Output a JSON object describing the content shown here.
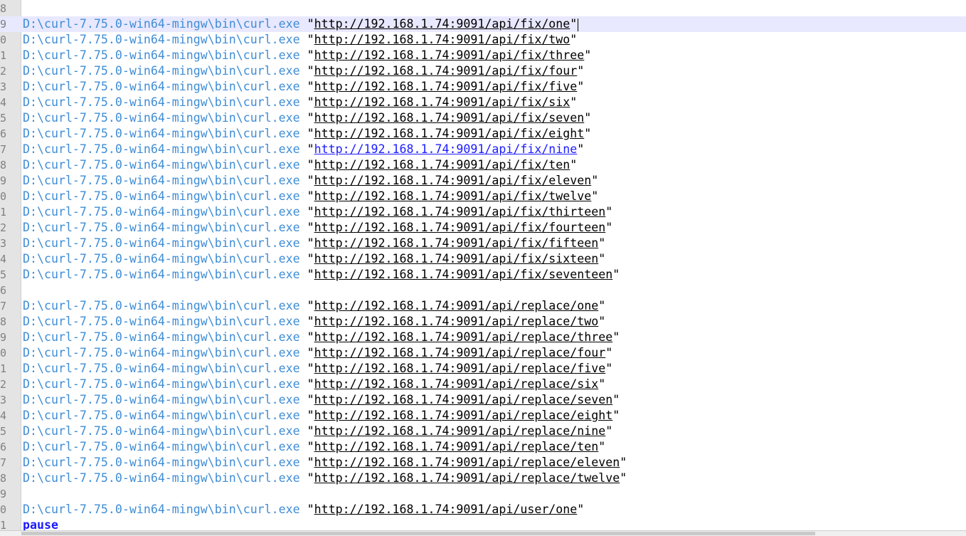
{
  "editor": {
    "curl_path": "D:\\curl-7.75.0-win64-mingw\\bin\\curl.exe",
    "quote": "\"",
    "lines": [
      {
        "num": "8",
        "url": "",
        "keyword": ""
      },
      {
        "num": "9",
        "url": "http://192.168.1.74:9091/api/fix/one",
        "keyword": ""
      },
      {
        "num": "0",
        "url": "http://192.168.1.74:9091/api/fix/two",
        "keyword": ""
      },
      {
        "num": "1",
        "url": "http://192.168.1.74:9091/api/fix/three",
        "keyword": ""
      },
      {
        "num": "2",
        "url": "http://192.168.1.74:9091/api/fix/four",
        "keyword": ""
      },
      {
        "num": "3",
        "url": "http://192.168.1.74:9091/api/fix/five",
        "keyword": ""
      },
      {
        "num": "4",
        "url": "http://192.168.1.74:9091/api/fix/six",
        "keyword": ""
      },
      {
        "num": "5",
        "url": "http://192.168.1.74:9091/api/fix/seven",
        "keyword": ""
      },
      {
        "num": "6",
        "url": "http://192.168.1.74:9091/api/fix/eight",
        "keyword": ""
      },
      {
        "num": "7",
        "url": "http://192.168.1.74:9091/api/fix/nine",
        "keyword": ""
      },
      {
        "num": "8",
        "url": "http://192.168.1.74:9091/api/fix/ten",
        "keyword": ""
      },
      {
        "num": "9",
        "url": "http://192.168.1.74:9091/api/fix/eleven",
        "keyword": ""
      },
      {
        "num": "0",
        "url": "http://192.168.1.74:9091/api/fix/twelve",
        "keyword": ""
      },
      {
        "num": "1",
        "url": "http://192.168.1.74:9091/api/fix/thirteen",
        "keyword": ""
      },
      {
        "num": "2",
        "url": "http://192.168.1.74:9091/api/fix/fourteen",
        "keyword": ""
      },
      {
        "num": "3",
        "url": "http://192.168.1.74:9091/api/fix/fifteen",
        "keyword": ""
      },
      {
        "num": "4",
        "url": "http://192.168.1.74:9091/api/fix/sixteen",
        "keyword": ""
      },
      {
        "num": "5",
        "url": "http://192.168.1.74:9091/api/fix/seventeen",
        "keyword": ""
      },
      {
        "num": "6",
        "url": "",
        "keyword": ""
      },
      {
        "num": "7",
        "url": "http://192.168.1.74:9091/api/replace/one",
        "keyword": ""
      },
      {
        "num": "8",
        "url": "http://192.168.1.74:9091/api/replace/two",
        "keyword": ""
      },
      {
        "num": "9",
        "url": "http://192.168.1.74:9091/api/replace/three",
        "keyword": ""
      },
      {
        "num": "0",
        "url": "http://192.168.1.74:9091/api/replace/four",
        "keyword": ""
      },
      {
        "num": "1",
        "url": "http://192.168.1.74:9091/api/replace/five",
        "keyword": ""
      },
      {
        "num": "2",
        "url": "http://192.168.1.74:9091/api/replace/six",
        "keyword": ""
      },
      {
        "num": "3",
        "url": "http://192.168.1.74:9091/api/replace/seven",
        "keyword": ""
      },
      {
        "num": "4",
        "url": "http://192.168.1.74:9091/api/replace/eight",
        "keyword": ""
      },
      {
        "num": "5",
        "url": "http://192.168.1.74:9091/api/replace/nine",
        "keyword": ""
      },
      {
        "num": "6",
        "url": "http://192.168.1.74:9091/api/replace/ten",
        "keyword": ""
      },
      {
        "num": "7",
        "url": "http://192.168.1.74:9091/api/replace/eleven",
        "keyword": ""
      },
      {
        "num": "8",
        "url": "http://192.168.1.74:9091/api/replace/twelve",
        "keyword": ""
      },
      {
        "num": "9",
        "url": "",
        "keyword": ""
      },
      {
        "num": "0",
        "url": "http://192.168.1.74:9091/api/user/one",
        "keyword": ""
      },
      {
        "num": "1",
        "url": "",
        "keyword": "pause"
      }
    ],
    "current_line_index": 1,
    "hover_link_index": 9,
    "colors": {
      "path": "#3f8dd6",
      "link_hover": "#1c1cff",
      "keyword": "#1a1aff",
      "current_line": "#e8e8ff"
    }
  }
}
